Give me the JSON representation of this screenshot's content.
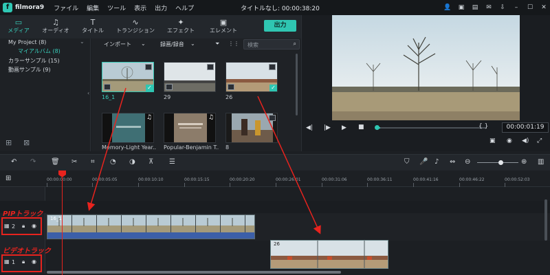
{
  "app": {
    "logo_mark": "f",
    "logo": "filmora9",
    "window_title": "タイトルなし: 00:00:38:20",
    "menu": [
      "ファイル",
      "編集",
      "ツール",
      "表示",
      "出力",
      "ヘルプ"
    ]
  },
  "media_tabs": [
    {
      "label": "メディア",
      "icon": "folder-icon",
      "glyph": "▭"
    },
    {
      "label": "オーディオ",
      "icon": "music-note-icon",
      "glyph": "♫"
    },
    {
      "label": "タイトル",
      "icon": "title-text-icon",
      "glyph": "T"
    },
    {
      "label": "トランジション",
      "icon": "transition-icon",
      "glyph": "∿"
    },
    {
      "label": "エフェクト",
      "icon": "effect-icon",
      "glyph": "✦"
    },
    {
      "label": "エレメント",
      "icon": "element-icon",
      "glyph": "▣"
    }
  ],
  "export_label": "出力",
  "tree": {
    "project": "My Project (8)",
    "album": "マイアルバム (8)",
    "color_sample": "カラーサンプル (15)",
    "video_sample": "動画サンプル (9)"
  },
  "library": {
    "import_label": "インポート",
    "record_label": "録画/録音",
    "search_placeholder": "検索",
    "items": [
      {
        "label": "16_1",
        "selected": true
      },
      {
        "label": "29",
        "selected": false
      },
      {
        "label": "26",
        "selected": false
      },
      {
        "label": "Memory-Light Year...",
        "selected": false
      },
      {
        "label": "Popular-Benjamin T...",
        "selected": false
      },
      {
        "label": "8",
        "selected": false
      }
    ],
    "thumb_caption_1": "",
    "thumb_caption_2": ""
  },
  "preview": {
    "timecode": "00:00:01:19",
    "brackets": "{ }",
    "scrub_fraction": 0.04
  },
  "ruler": {
    "ticks": [
      "00:00:00:00",
      "00:00:05:05",
      "00:00:10:10",
      "00:00:15:15",
      "00:00:20:20",
      "00:00:26:01",
      "00:00:31:06",
      "00:00:36:11",
      "00:00:41:16",
      "00:00:46:22",
      "00:00:52:03"
    ]
  },
  "tracks": {
    "pip": {
      "number": "2",
      "clip_name": "16_1",
      "annotation": "PIPトラック"
    },
    "video": {
      "number": "1",
      "clip_name": "26",
      "annotation": "ビデオトラック"
    }
  },
  "colors": {
    "accent": "#2fc6b2",
    "annotation": "#e8231e",
    "audio": "#3c5fa8"
  }
}
